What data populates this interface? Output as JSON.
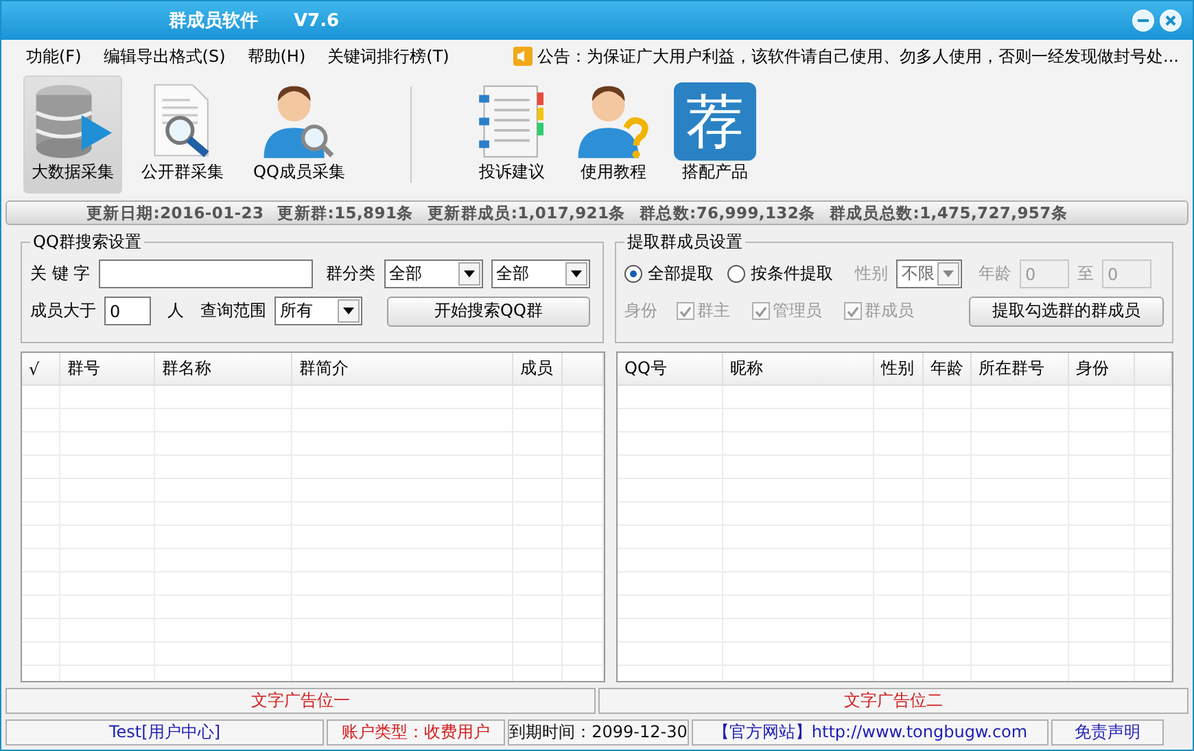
{
  "window": {
    "title": "群成员软件",
    "version": "V7.6"
  },
  "menu": [
    {
      "label": "功能(F)"
    },
    {
      "label": "编辑导出格式(S)"
    },
    {
      "label": "帮助(H)"
    },
    {
      "label": "关键词排行榜(T)"
    }
  ],
  "notice": "公告：为保证广大用户利益，该软件请自己使用、勿多人使用，否则一经发现做封号处...",
  "toolbar_left": [
    {
      "label": "大数据采集",
      "selected": true
    },
    {
      "label": "公开群采集",
      "selected": false
    },
    {
      "label": "QQ成员采集",
      "selected": false
    }
  ],
  "toolbar_right": [
    {
      "label": "投诉建议",
      "selected": false
    },
    {
      "label": "使用教程",
      "selected": false
    },
    {
      "label": "搭配产品",
      "glyph": "荐",
      "selected": false
    }
  ],
  "stats": [
    "更新日期:2016-01-23",
    "更新群:15,891条",
    "更新群成员:1,017,921条",
    "群总数:76,999,132条",
    "群成员总数:1,475,727,957条"
  ],
  "search_group": {
    "title": "QQ群搜索设置",
    "keyword_label": "关 键 字",
    "category_label": "群分类",
    "category1": "全部",
    "category2": "全部",
    "member_label": "成员大于",
    "member_value": "0",
    "member_unit": "人",
    "scope_label": "查询范围",
    "scope": "所有",
    "button": "开始搜索QQ群"
  },
  "extract_group": {
    "title": "提取群成员设置",
    "modes": [
      {
        "label": "全部提取",
        "selected": true
      },
      {
        "label": "按条件提取",
        "selected": false
      }
    ],
    "conditions_disabled": true,
    "gender_label": "性别",
    "gender": "不限",
    "age_label": "年龄",
    "age_from": "0",
    "age_to_label": "至",
    "age_to": "0",
    "role_label": "身份",
    "roles": [
      {
        "label": "群主",
        "checked": true
      },
      {
        "label": "管理员",
        "checked": true
      },
      {
        "label": "群成员",
        "checked": true
      }
    ],
    "button": "提取勾选群的群成员"
  },
  "group_table": {
    "columns": [
      "√",
      "群号",
      "群名称",
      "群简介",
      "成员"
    ]
  },
  "member_table": {
    "columns": [
      "QQ号",
      "昵称",
      "性别",
      "年龄",
      "所在群号",
      "身份"
    ]
  },
  "ads": [
    "文字广告位一",
    "文字广告位二"
  ],
  "status_bar": [
    {
      "text": "Test[用户中心]",
      "color": "#1e1eb4"
    },
    {
      "text": "账户类型：收费用户",
      "color": "#d21e1e"
    },
    {
      "text": "到期时间：2099-12-30",
      "color": "#111111"
    },
    {
      "text": "【官方网站】http://www.tongbugw.com",
      "color": "#1e1eb4"
    },
    {
      "text": "免责声明",
      "color": "#1e1eb4"
    }
  ]
}
